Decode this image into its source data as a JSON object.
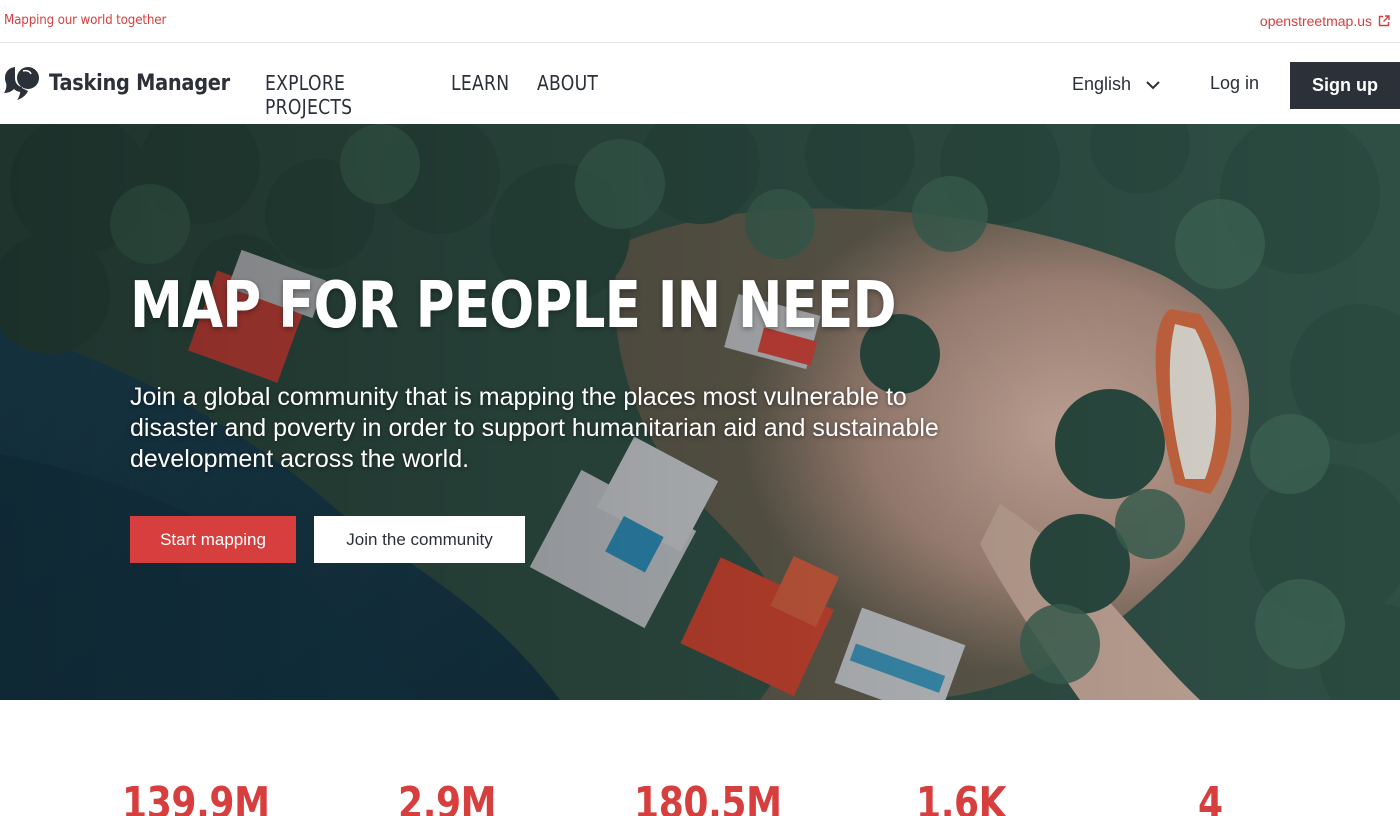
{
  "topbar": {
    "tagline": "Mapping our world together",
    "osm_link": "openstreetmap.us"
  },
  "nav": {
    "brand": "Tasking Manager",
    "menu": [
      "EXPLORE PROJECTS",
      "LEARN",
      "ABOUT"
    ],
    "language": "English",
    "login": "Log in",
    "signup": "Sign up"
  },
  "hero": {
    "title": "MAP FOR PEOPLE IN NEED",
    "subtitle": "Join a global community that is mapping the places most vulnerable to disaster and poverty in order to support humanitarian aid and sustainable development across the world.",
    "primary_button": "Start mapping",
    "secondary_button": "Join the community"
  },
  "stats": [
    "139.9M",
    "2.9M",
    "180.5M",
    "1.6K",
    "4"
  ],
  "colors": {
    "accent": "#d73f3f",
    "dark": "#2c3038"
  },
  "icons": {
    "external": "external-link-icon",
    "logo": "tasking-manager-logo-icon",
    "dropdown": "chevron-down-icon"
  }
}
